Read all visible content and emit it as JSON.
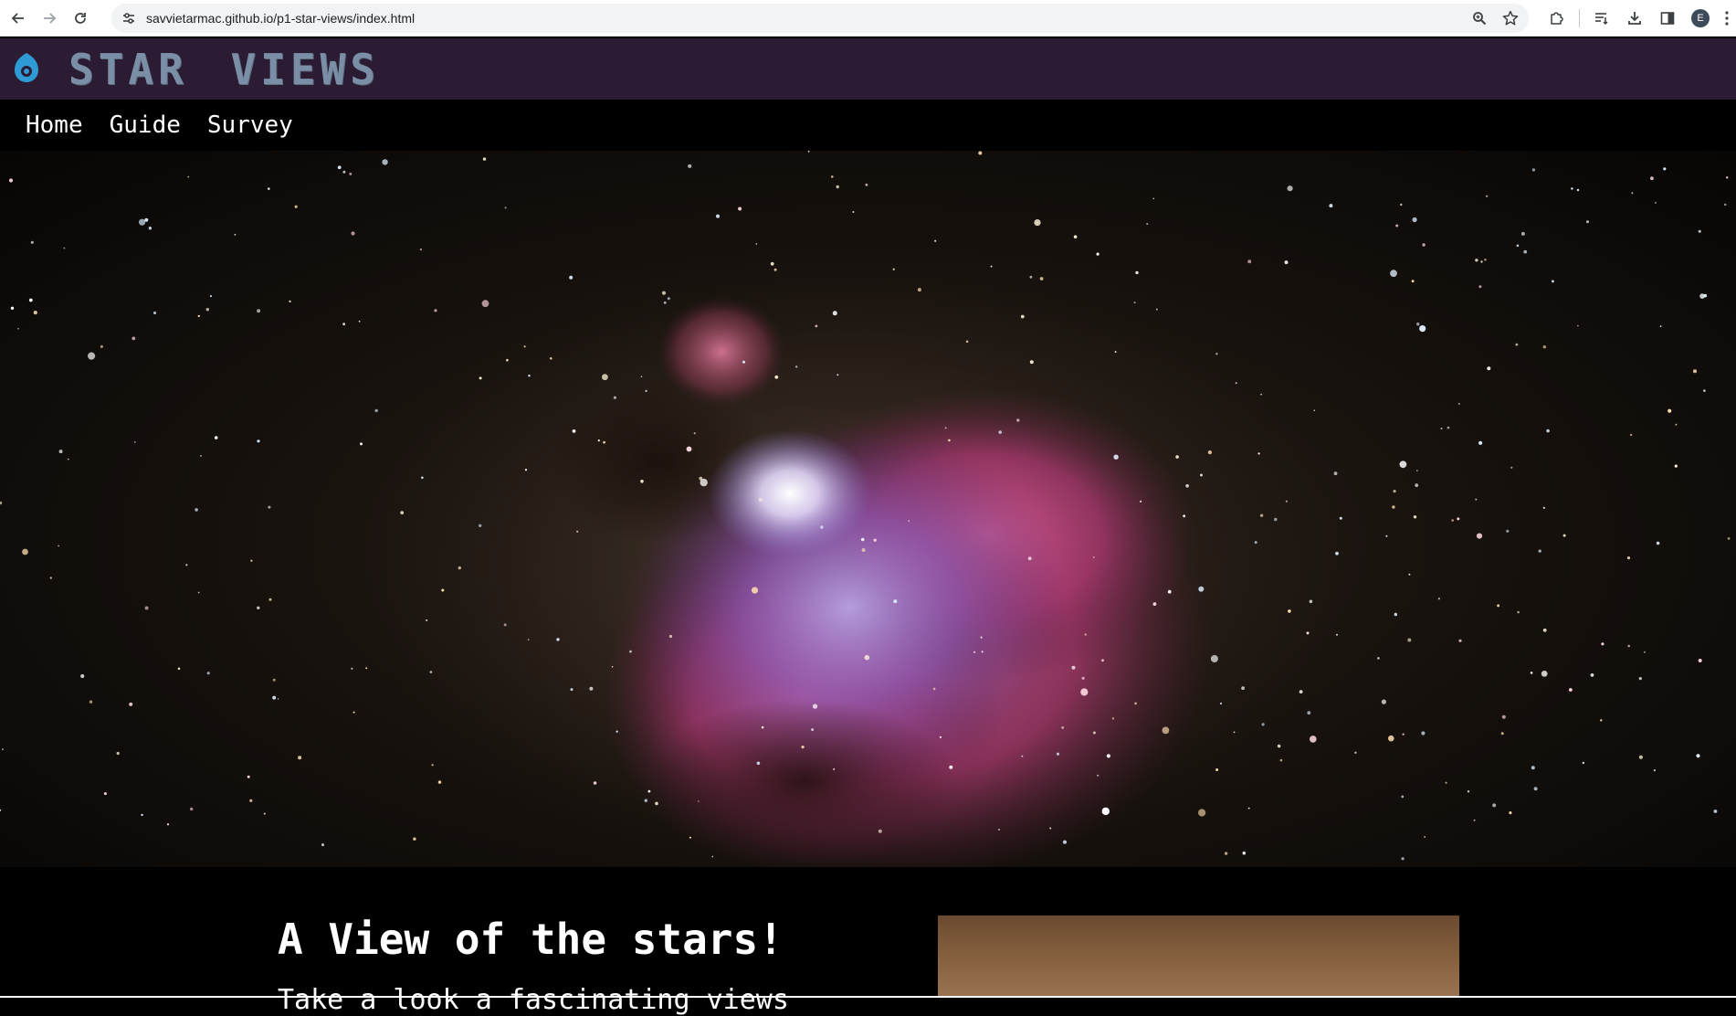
{
  "browser": {
    "url": "savvietarmac.github.io/p1-star-views/index.html",
    "profile_initial": "E",
    "icons": {
      "back": "back-arrow-icon",
      "forward": "forward-arrow-icon",
      "reload": "reload-icon",
      "site_info": "tune-icon",
      "zoom": "zoom-icon",
      "bookmark": "star-icon",
      "extensions": "puzzle-icon",
      "reading_list": "reading-list-icon",
      "downloads": "download-icon",
      "side_panel": "side-panel-icon",
      "menu": "kebab-menu-icon"
    }
  },
  "header": {
    "title": "STAR VIEWS",
    "logo": "ring-logo-icon",
    "colors": {
      "background": "#2b1b33",
      "title": "#7a8fa6",
      "logo": "#2f9bd6"
    }
  },
  "nav": {
    "items": [
      {
        "label": "Home"
      },
      {
        "label": "Guide"
      },
      {
        "label": "Survey"
      }
    ]
  },
  "hero": {
    "image": "orion-nebula-photo"
  },
  "content": {
    "title": "A View of the stars!",
    "text": "Take a look a fascinating views"
  }
}
